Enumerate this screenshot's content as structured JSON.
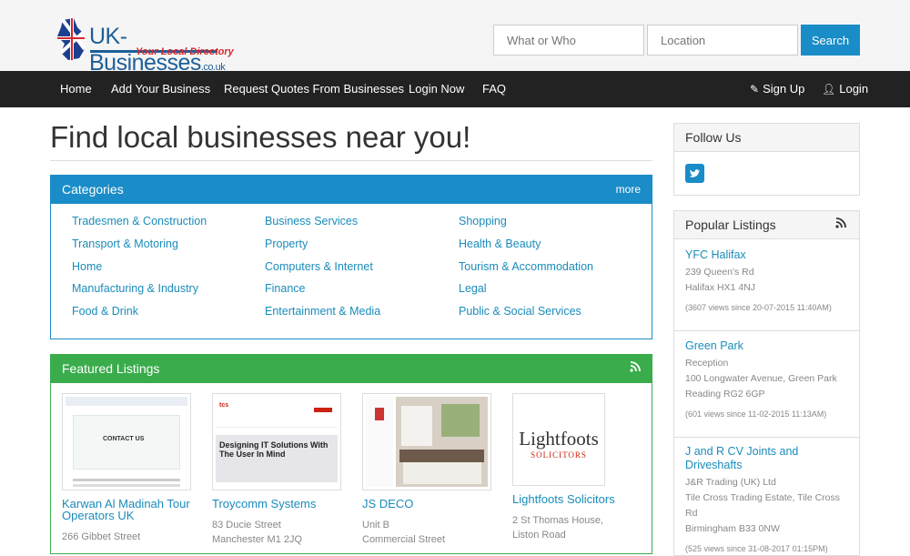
{
  "header": {
    "logo_name": "UK-Businesses",
    "logo_tld": ".co.uk",
    "logo_tagline": "Your Local Directory",
    "search_what_placeholder": "What or Who",
    "search_where_placeholder": "Location",
    "search_button": "Search"
  },
  "nav": {
    "items": [
      "Home",
      "Add Your Business",
      "Request Quotes From Businesses",
      "Login Now",
      "FAQ"
    ],
    "signup": "Sign Up",
    "login": "Login"
  },
  "main": {
    "title": "Find local businesses near you!",
    "categories": {
      "heading": "Categories",
      "more": "more",
      "col1": [
        "Tradesmen & Construction",
        "Transport & Motoring",
        "Home",
        "Manufacturing & Industry",
        "Food & Drink"
      ],
      "col2": [
        "Business Services",
        "Property",
        "Computers & Internet",
        "Finance",
        "Entertainment & Media"
      ],
      "col3": [
        "Shopping",
        "Health & Beauty",
        "Tourism & Accommodation",
        "Legal",
        "Public & Social Services"
      ]
    },
    "featured": {
      "heading": "Featured Listings",
      "listings": [
        {
          "name": "Karwan Al Madinah Tour Operators UK",
          "addr1": "266 Gibbet Street",
          "thumb_text": "CONTACT US"
        },
        {
          "name": "Troycomm Systems",
          "addr1": "83 Ducie Street",
          "addr2": "Manchester M1 2JQ",
          "thumb_text": "Designing IT Solutions With The User In Mind"
        },
        {
          "name": "JS DECO",
          "addr1": "Unit B",
          "addr2": "Commercial Street"
        },
        {
          "name": "Lightfoots Solicitors",
          "addr1": "2 St Thomas House, Liston Road",
          "thumb_text": "Lightfoots",
          "thumb_sub": "SOLICITORS"
        }
      ]
    }
  },
  "sidebar": {
    "follow_heading": "Follow Us",
    "popular_heading": "Popular Listings",
    "popular": [
      {
        "name": "YFC Halifax",
        "lines": [
          "239 Queen's Rd",
          "Halifax HX1 4NJ"
        ],
        "views": "(3607 views since 20-07-2015 11:40AM)"
      },
      {
        "name": "Green Park",
        "lines": [
          "Reception",
          "100 Longwater Avenue, Green Park",
          "Reading RG2 6GP"
        ],
        "views": "(601 views since 11-02-2015 11:13AM)"
      },
      {
        "name": "J and R CV Joints and Driveshafts",
        "lines": [
          "J&R Trading (UK) Ltd",
          "Tile Cross Trading Estate, Tile Cross Rd",
          "Birmingham B33 0NW"
        ],
        "views": "(525 views since 31-08-2017 01:15PM)"
      }
    ]
  }
}
